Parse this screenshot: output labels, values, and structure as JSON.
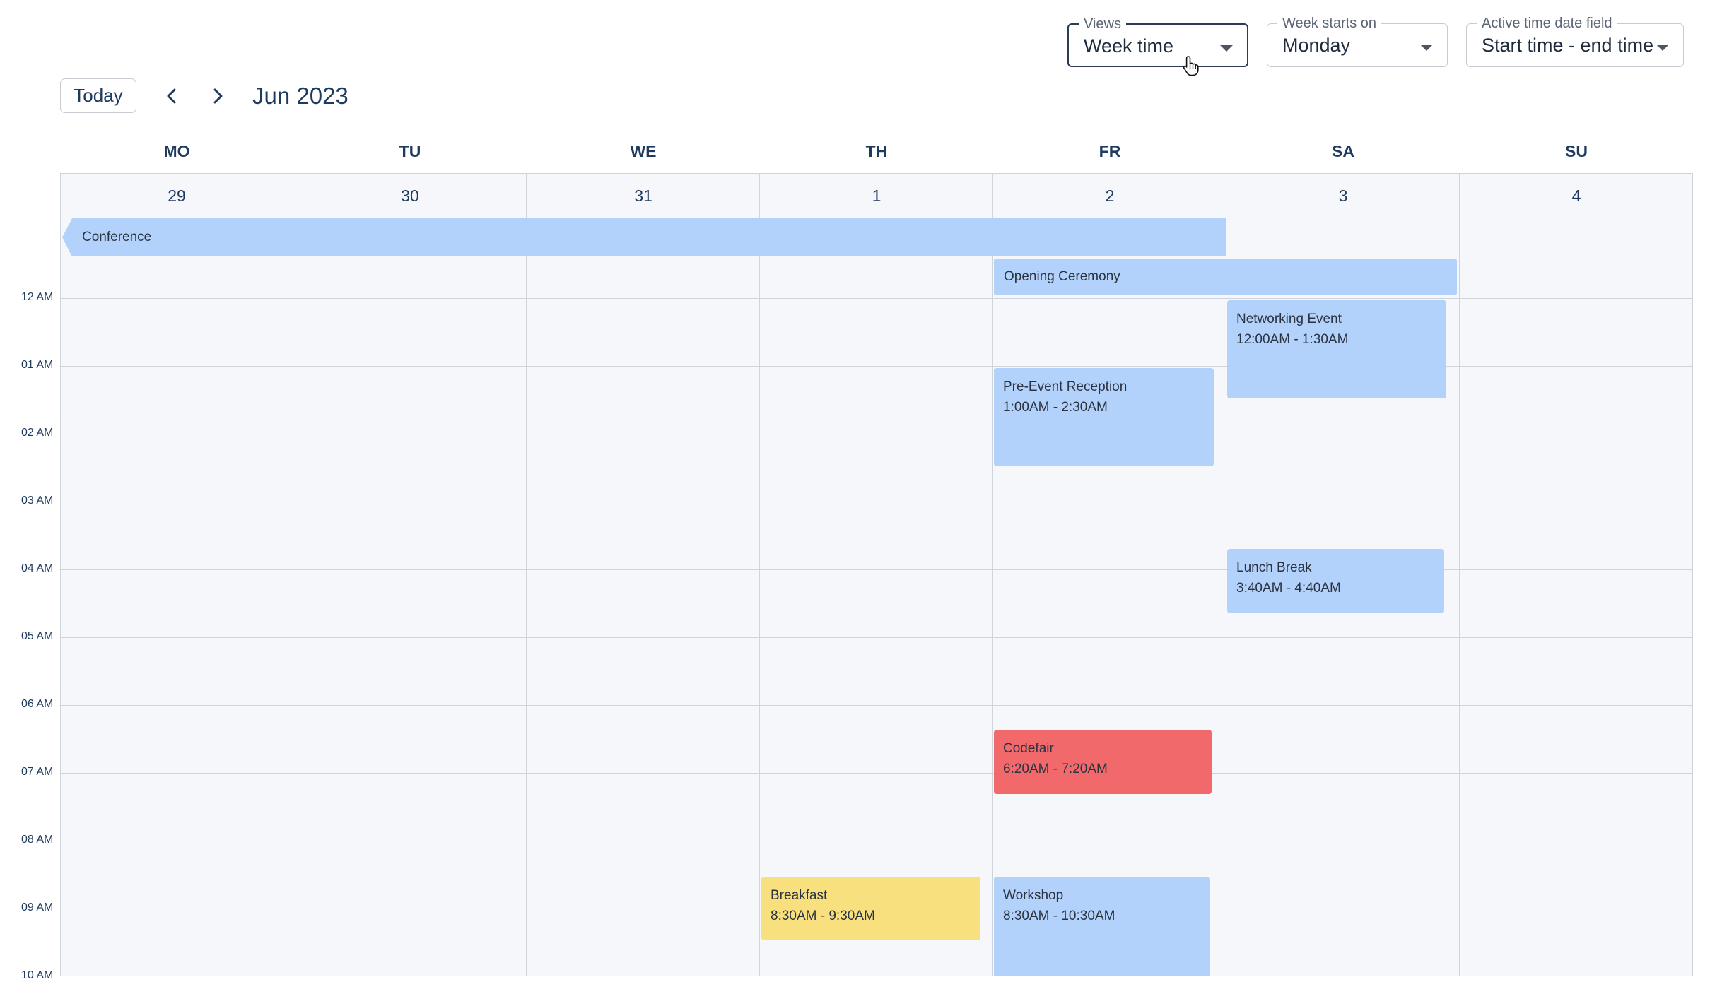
{
  "toolbar": {
    "views": {
      "label": "Views",
      "value": "Week time"
    },
    "week_start": {
      "label": "Week starts on",
      "value": "Monday"
    },
    "active_field": {
      "label": "Active time date field",
      "value": "Start time - end time"
    }
  },
  "nav": {
    "today_label": "Today",
    "month": "Jun 2023"
  },
  "days": [
    {
      "name": "MO",
      "date": "29"
    },
    {
      "name": "TU",
      "date": "30"
    },
    {
      "name": "WE",
      "date": "31"
    },
    {
      "name": "TH",
      "date": "1"
    },
    {
      "name": "FR",
      "date": "2"
    },
    {
      "name": "SA",
      "date": "3"
    },
    {
      "name": "SU",
      "date": "4"
    }
  ],
  "time_labels": [
    "12 AM",
    "01 AM",
    "02 AM",
    "03 AM",
    "04 AM",
    "05 AM",
    "06 AM",
    "07 AM",
    "08 AM",
    "09 AM",
    "10 AM"
  ],
  "all_day_events": [
    {
      "title": "Conference"
    },
    {
      "title": "Opening Ceremony"
    }
  ],
  "events": [
    {
      "title": "Networking Event",
      "time": "12:00AM - 1:30AM"
    },
    {
      "title": "Pre-Event Reception",
      "time": "1:00AM - 2:30AM"
    },
    {
      "title": "Lunch Break",
      "time": "3:40AM - 4:40AM"
    },
    {
      "title": "Codefair",
      "time": "6:20AM - 7:20AM"
    },
    {
      "title": "Breakfast",
      "time": "8:30AM - 9:30AM"
    },
    {
      "title": "Workshop",
      "time": "8:30AM - 10:30AM"
    }
  ],
  "colors": {
    "accent": "#1f3a5f",
    "event_blue": "#b3d2fb",
    "event_red": "#f2696b",
    "event_yellow": "#f9e07e"
  },
  "icons": {
    "prev": "chevron-left-icon",
    "next": "chevron-right-icon",
    "dropdown": "caret-down-icon",
    "cursor": "hand-pointer-icon"
  }
}
